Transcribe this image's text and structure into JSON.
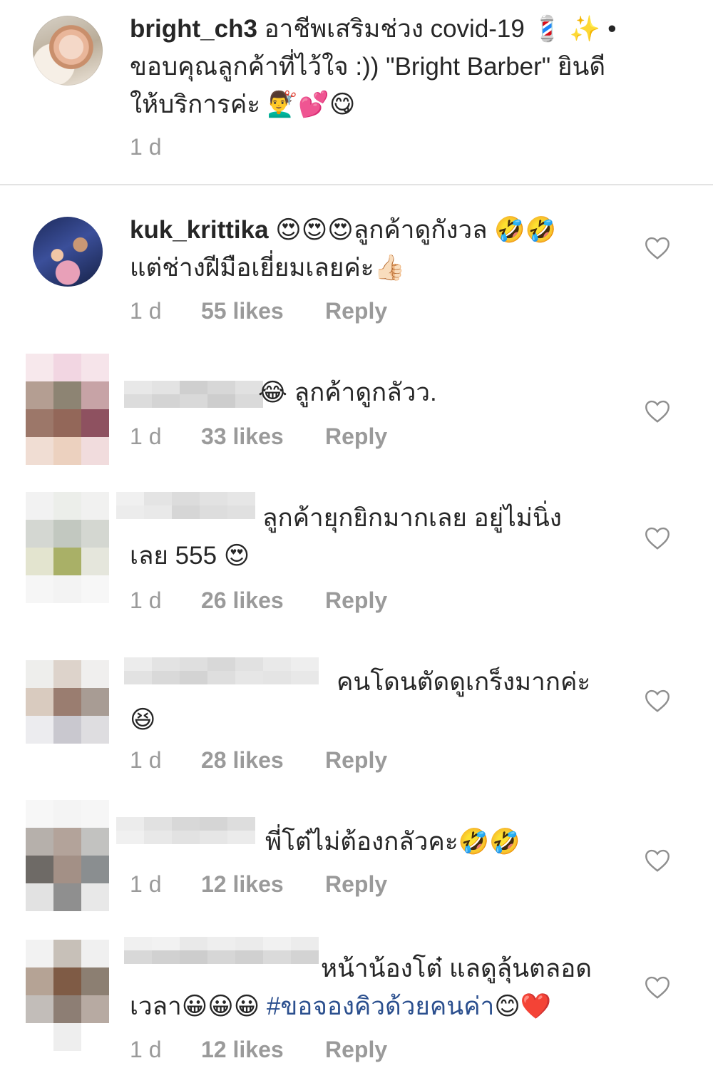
{
  "caption": {
    "username": "bright_ch3",
    "line1": "อาชีพเสริมช่วง covid-19 💈 ✨ •",
    "line2": "ขอบคุณลูกค้าที่ไว้ใจ :)) \"Bright Barber\" ยินดี",
    "line3": "ให้บริการค่ะ 💇‍♂️💕😋",
    "time": "1 d"
  },
  "comments": [
    {
      "username": "kuk_krittika",
      "line1": "😍😍😍ลูกค้าดูกังวล 🤣🤣",
      "line2": "แต่ช่างฝีมือเยี่ยมเลยค่ะ👍🏻",
      "time": "1 d",
      "likes": "55 likes",
      "reply": "Reply"
    },
    {
      "line1": "😂 ลูกค้าดูกลัวว.",
      "time": "1 d",
      "likes": "33 likes",
      "reply": "Reply"
    },
    {
      "line1": "ลูกค้ายุกยิกมากเลย อยู่ไม่นิ่ง",
      "line2": "เลย 555 😍",
      "time": "1 d",
      "likes": "26 likes",
      "reply": "Reply"
    },
    {
      "line1": "คนโดนตัดดูเกร็งมากค่ะ",
      "line2": "😆",
      "time": "1 d",
      "likes": "28 likes",
      "reply": "Reply"
    },
    {
      "line1": "พี่โต๋ไม่ต้องกลัวคะ🤣🤣",
      "time": "1 d",
      "likes": "12 likes",
      "reply": "Reply"
    },
    {
      "line1": "หน้าน้องโต๋ แลดูลุ้นตลอด",
      "line2_start": "เวลา😀😀😀 ",
      "hashtag": "#ขอจองคิวด้วยคนค่า",
      "line2_end": "😊❤️",
      "time": "1 d",
      "likes": "12 likes",
      "reply": "Reply"
    }
  ],
  "colors": {
    "text": "#262626",
    "meta": "#9a9a9a",
    "hashtag": "#2b4f8e",
    "divider": "#e3e3e3"
  },
  "icons": {
    "like": "heart-outline-icon"
  }
}
